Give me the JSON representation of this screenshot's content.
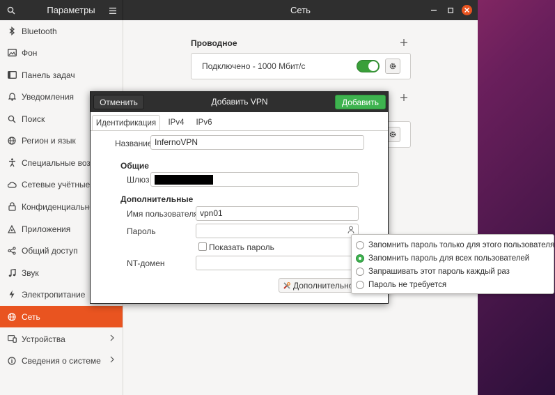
{
  "header": {
    "left_title": "Параметры",
    "title": "Сеть"
  },
  "sidebar": {
    "items": [
      {
        "label": "Bluetooth",
        "icon": "bluetooth-icon"
      },
      {
        "label": "Фон",
        "icon": "background-icon"
      },
      {
        "label": "Панель задач",
        "icon": "dock-icon"
      },
      {
        "label": "Уведомления",
        "icon": "bell-icon"
      },
      {
        "label": "Поиск",
        "icon": "search-icon"
      },
      {
        "label": "Регион и язык",
        "icon": "globe-icon"
      },
      {
        "label": "Специальные возмо",
        "icon": "accessibility-icon"
      },
      {
        "label": "Сетевые учётные за",
        "icon": "cloud-icon"
      },
      {
        "label": "Конфиденциальность",
        "icon": "lock-icon"
      },
      {
        "label": "Приложения",
        "icon": "apps-icon"
      },
      {
        "label": "Общий доступ",
        "icon": "share-icon"
      },
      {
        "label": "Звук",
        "icon": "music-note-icon"
      },
      {
        "label": "Электропитание",
        "icon": "power-icon"
      },
      {
        "label": "Сеть",
        "icon": "network-icon",
        "active": true
      },
      {
        "label": "Устройства",
        "icon": "devices-icon",
        "chevron": true
      },
      {
        "label": "Сведения о системе",
        "icon": "info-icon",
        "chevron": true
      }
    ]
  },
  "content": {
    "wired_title": "Проводное",
    "wired_status": "Подключено - 1000 Мбит/с",
    "wired_toggle_on": true
  },
  "dialog": {
    "cancel_label": "Отменить",
    "title": "Добавить VPN",
    "add_label": "Добавить",
    "tabs": [
      "Идентификация",
      "IPv4",
      "IPv6"
    ],
    "name_label": "Название",
    "name_value": "InfernoVPN",
    "general_title": "Общие",
    "gateway_label": "Шлюз",
    "additional_title": "Дополнительные",
    "username_label": "Имя пользователя",
    "username_value": "vpn01",
    "password_label": "Пароль",
    "password_value": "",
    "show_password_label": "Показать пароль",
    "nt_domain_label": "NT-домен",
    "nt_domain_value": "",
    "advanced_label": "Дополнительно..."
  },
  "password_menu": {
    "options": [
      {
        "label": "Запомнить пароль только для этого пользователя",
        "selected": false
      },
      {
        "label": "Запомнить пароль для всех пользователей",
        "selected": true
      },
      {
        "label": "Запрашивать этот пароль каждый раз",
        "selected": false
      },
      {
        "label": "Пароль не требуется",
        "selected": false
      }
    ]
  },
  "colors": {
    "accent": "#e95420",
    "header_bg": "#2f2f2f",
    "add_button": "#3eb34f"
  }
}
